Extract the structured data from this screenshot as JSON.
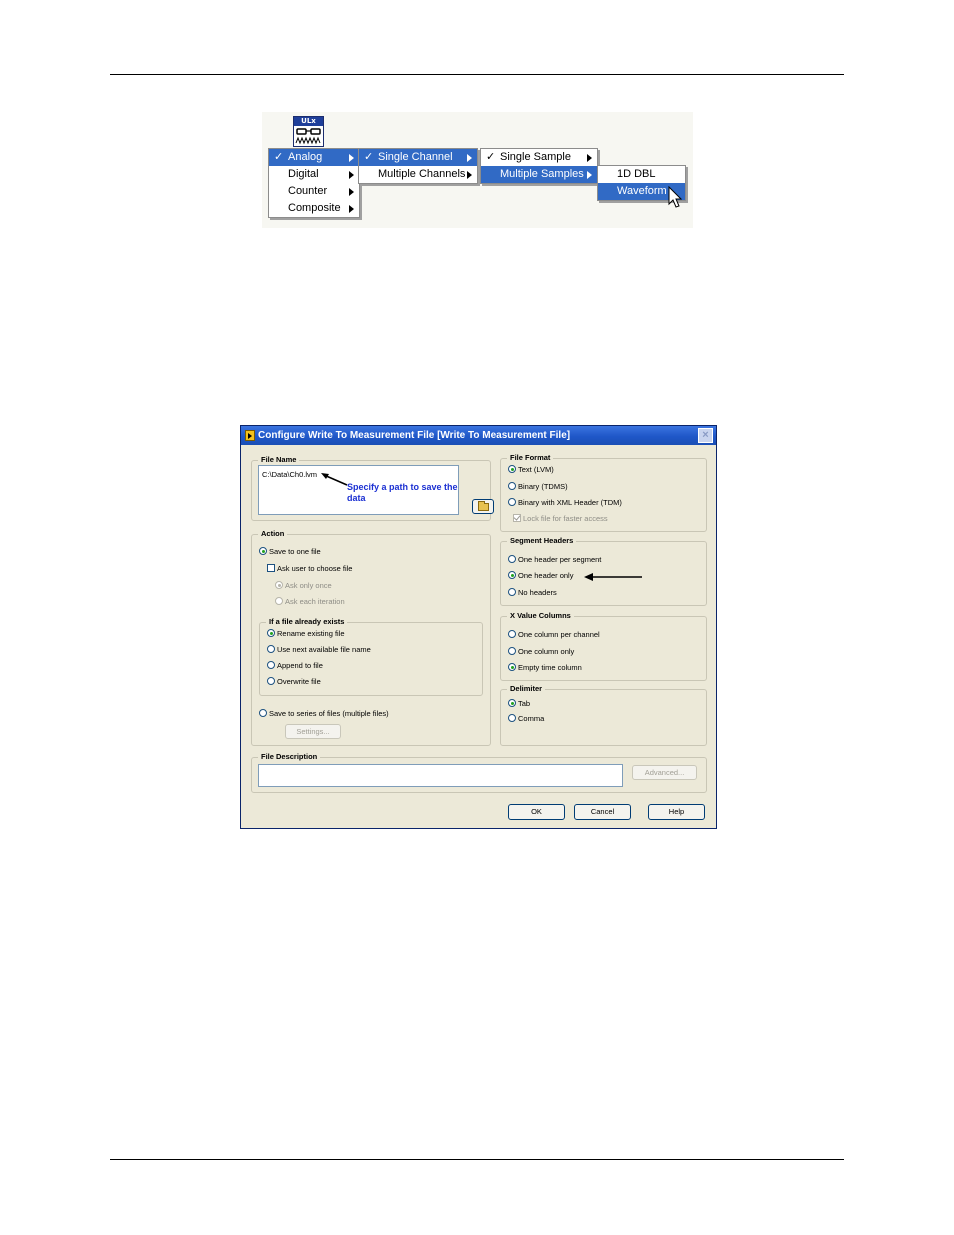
{
  "menu": {
    "icon_label": "ULx",
    "level1": [
      {
        "label": "Analog",
        "checked": true,
        "selected": true
      },
      {
        "label": "Digital",
        "checked": false,
        "selected": false
      },
      {
        "label": "Counter",
        "checked": false,
        "selected": false
      },
      {
        "label": "Composite",
        "checked": false,
        "selected": false
      }
    ],
    "level2": [
      {
        "label": "Single Channel",
        "checked": true,
        "selected": true
      },
      {
        "label": "Multiple Channels",
        "checked": false,
        "selected": false
      }
    ],
    "level3": [
      {
        "label": "Single Sample",
        "checked": true,
        "selected": false
      },
      {
        "label": "Multiple Samples",
        "checked": false,
        "selected": true
      }
    ],
    "level4": [
      {
        "label": "1D DBL",
        "selected": false
      },
      {
        "label": "Waveform",
        "selected": true
      }
    ],
    "check_glyph": "✓"
  },
  "dialog": {
    "title": "Configure Write To Measurement File [Write To Measurement File]",
    "file_name": {
      "title": "File Name",
      "path": "C:\\Data\\Ch0.lvm",
      "note": "Specify a path to save the data"
    },
    "file_format": {
      "title": "File Format",
      "options": [
        "Text (LVM)",
        "Binary (TDMS)",
        "Binary with XML Header (TDM)"
      ],
      "selected": 0,
      "lock_label": "Lock file for faster access"
    },
    "action": {
      "title": "Action",
      "save_one": "Save to one file",
      "ask_user": "Ask user to choose file",
      "ask_once": "Ask only once",
      "ask_each": "Ask each iteration",
      "exists_title": "If a file already exists",
      "exists_options": [
        "Rename existing file",
        "Use next available file name",
        "Append to file",
        "Overwrite file"
      ],
      "exists_selected": 0,
      "save_series": "Save to series of files (multiple files)",
      "settings_button": "Settings..."
    },
    "segment_headers": {
      "title": "Segment Headers",
      "options": [
        "One header per segment",
        "One header only",
        "No headers"
      ],
      "selected": 1
    },
    "x_value_columns": {
      "title": "X Value Columns",
      "options": [
        "One column per channel",
        "One column only",
        "Empty time column"
      ],
      "selected": 2
    },
    "delimiter": {
      "title": "Delimiter",
      "options": [
        "Tab",
        "Comma"
      ],
      "selected": 0
    },
    "file_description": {
      "title": "File Description",
      "advanced_button": "Advanced..."
    },
    "buttons": {
      "ok": "OK",
      "cancel": "Cancel",
      "help": "Help"
    },
    "colors": {
      "title_bar": "#1f57c8",
      "dialog_bg": "#ece9d8",
      "annotation": "#1a2fd2"
    }
  }
}
